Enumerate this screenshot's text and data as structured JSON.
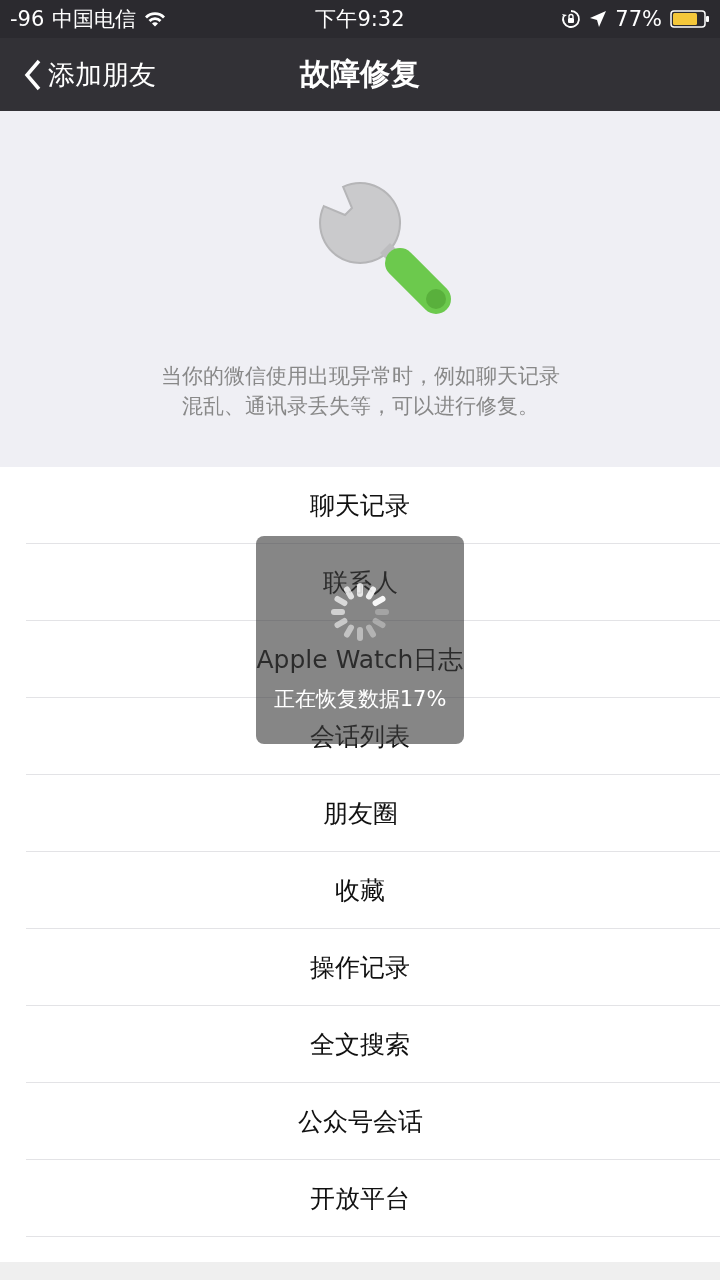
{
  "status_bar": {
    "signal": "-96",
    "carrier": "中国电信",
    "time": "下午9:32",
    "battery": "77%"
  },
  "nav": {
    "back": "添加朋友",
    "title": "故障修复"
  },
  "header": {
    "description_lines": [
      "当你的微信使用出现异常时，例如聊天记录",
      "混乱、通讯录丢失等，可以进行修复。"
    ]
  },
  "items": [
    {
      "label": "聊天记录"
    },
    {
      "label": "联系人"
    },
    {
      "label": "Apple Watch日志"
    },
    {
      "label": "会话列表"
    },
    {
      "label": "朋友圈"
    },
    {
      "label": "收藏"
    },
    {
      "label": "操作记录"
    },
    {
      "label": "全文搜索"
    },
    {
      "label": "公众号会话"
    },
    {
      "label": "开放平台"
    }
  ],
  "progress_toast": {
    "message": "正在恢复数据17%"
  }
}
